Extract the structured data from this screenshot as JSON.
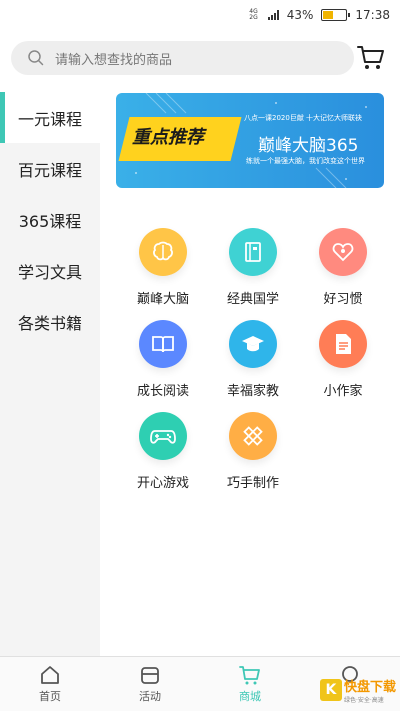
{
  "status": {
    "network": "4G\n2G",
    "battery_pct": "43%",
    "battery_level": 0.43,
    "time": "17:38"
  },
  "search": {
    "placeholder": "请输入想查找的商品"
  },
  "sidebar": {
    "items": [
      {
        "label": "一元课程",
        "active": true
      },
      {
        "label": "百元课程"
      },
      {
        "label": "365课程"
      },
      {
        "label": "学习文具"
      },
      {
        "label": "各类书籍"
      }
    ]
  },
  "banner": {
    "tag": "重点推荐",
    "top_line": "八点一课2020巨献  十大记忆大师联袂",
    "title": "巅峰大脑365",
    "subtitle": "练就一个最强大脑，我们改变这个世界"
  },
  "grid": {
    "items": [
      {
        "label": "巅峰大脑",
        "icon": "brain-icon",
        "color": "#ffc547"
      },
      {
        "label": "经典国学",
        "icon": "book-icon",
        "color": "#3fd2d3"
      },
      {
        "label": "好习惯",
        "icon": "heart-icon",
        "color": "#ff8a7f"
      },
      {
        "label": "成长阅读",
        "icon": "open-book-icon",
        "color": "#5b88ff"
      },
      {
        "label": "幸福家教",
        "icon": "graduation-cap-icon",
        "color": "#2fb5ea"
      },
      {
        "label": "小作家",
        "icon": "document-icon",
        "color": "#ff7d56"
      },
      {
        "label": "开心游戏",
        "icon": "gamepad-icon",
        "color": "#2ecfb2"
      },
      {
        "label": "巧手制作",
        "icon": "pencil-ruler-icon",
        "color": "#ffae45"
      }
    ]
  },
  "bottom_nav": {
    "items": [
      {
        "label": "首页",
        "icon": "home-icon"
      },
      {
        "label": "活动",
        "icon": "activity-icon"
      },
      {
        "label": "商城",
        "icon": "cart-icon",
        "active": true
      },
      {
        "label": "",
        "icon": "profile-icon"
      }
    ]
  },
  "watermark": {
    "brand": "快盘下载",
    "letter": "K",
    "tagline": "绿色·安全·高速"
  },
  "colors": {
    "accent": "#3ec7b5",
    "banner_tag": "#ffd21e",
    "banner_bg": "#2a8fdd"
  }
}
